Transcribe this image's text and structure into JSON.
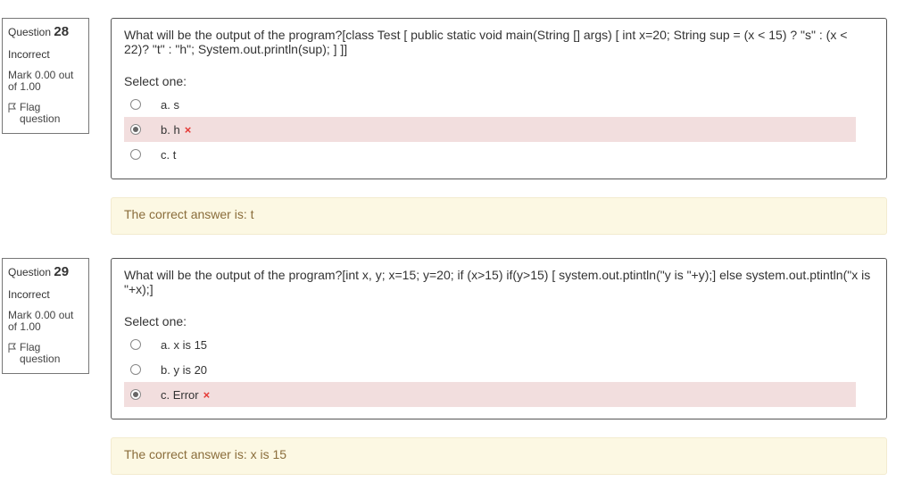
{
  "questions": [
    {
      "number_prefix": "Question",
      "number": "28",
      "state": "Incorrect",
      "grade": "Mark 0.00 out of 1.00",
      "flag_label": "Flag question",
      "text": "What will be the output of the program?[class Test [ public static void main(String [] args) [ int x=20; String sup = (x < 15) ? \"s\" : (x < 22)? \"t\" : \"h\"; System.out.println(sup); ] ]]",
      "prompt": "Select one:",
      "answers": [
        {
          "label": "a. s",
          "checked": false,
          "incorrect": false
        },
        {
          "label": "b. h",
          "checked": true,
          "incorrect": true
        },
        {
          "label": "c. t",
          "checked": false,
          "incorrect": false
        }
      ],
      "feedback": "The correct answer is: t"
    },
    {
      "number_prefix": "Question",
      "number": "29",
      "state": "Incorrect",
      "grade": "Mark 0.00 out of 1.00",
      "flag_label": "Flag question",
      "text": "What will be the output of the program?[int x, y; x=15; y=20; if (x>15) if(y>15) [ system.out.ptintln(\"y is \"+y);] else system.out.ptintln(\"x is \"+x);]",
      "prompt": "Select one:",
      "answers": [
        {
          "label": "a. x is 15",
          "checked": false,
          "incorrect": false
        },
        {
          "label": "b. y is 20",
          "checked": false,
          "incorrect": false
        },
        {
          "label": "c. Error",
          "checked": true,
          "incorrect": true
        }
      ],
      "feedback": "The correct answer is: x is 15"
    }
  ],
  "icons": {
    "flag": "flag-icon",
    "incorrect_mark": "×"
  },
  "colors": {
    "incorrect_bg": "#f2dede",
    "feedback_bg": "#fcf8e3",
    "feedback_text": "#8a6d3b",
    "x_mark": "#e53935"
  }
}
